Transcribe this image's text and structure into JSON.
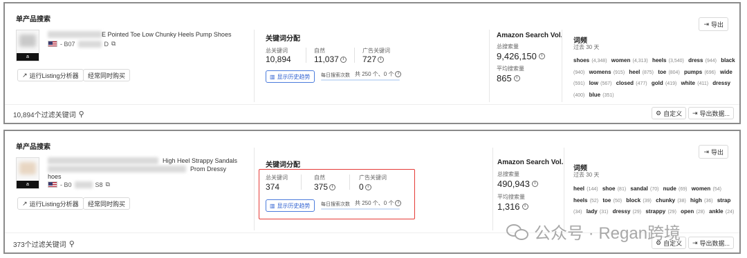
{
  "cards": [
    {
      "section_title": "单产品搜索",
      "export_label": "导出",
      "product_title": "E Pointed Toe Low Chunky Heels Pump Shoes",
      "product_title_2": "",
      "asin_prefix": "- B07",
      "asin_suffix": "D",
      "btn_listing": "运行Listing分析器",
      "btn_often": "经常同时购买",
      "kw": {
        "title": "关键词分配",
        "total_label": "总关键词",
        "total_value": "10,894",
        "organic_label": "自然",
        "organic_value": "11,037",
        "ad_label": "广告关键词",
        "ad_value": "727",
        "trend_btn": "显示历史趋势",
        "daily_label": "每日搜索次数",
        "daily_count": "共 250 个、0 个"
      },
      "amazon": {
        "title": "Amazon Search Vol.",
        "total_label": "总搜索量",
        "total_value": "9,426,150",
        "avg_label": "平均搜索量",
        "avg_value": "865"
      },
      "wordfreq": {
        "title": "词频",
        "subtitle": "过去 30 天",
        "words": [
          {
            "w": "shoes",
            "c": "(4,348)"
          },
          {
            "w": "women",
            "c": "(4,313)"
          },
          {
            "w": "heels",
            "c": "(3,540)"
          },
          {
            "w": "dress",
            "c": "(944)"
          },
          {
            "w": "black",
            "c": "(940)"
          },
          {
            "w": "womens",
            "c": "(915)"
          },
          {
            "w": "heel",
            "c": "(875)"
          },
          {
            "w": "toe",
            "c": "(804)"
          },
          {
            "w": "pumps",
            "c": "(696)"
          },
          {
            "w": "wide",
            "c": "(591)"
          },
          {
            "w": "low",
            "c": "(567)"
          },
          {
            "w": "closed",
            "c": "(477)"
          },
          {
            "w": "gold",
            "c": "(419)"
          },
          {
            "w": "white",
            "c": "(411)"
          },
          {
            "w": "dressy",
            "c": "(400)"
          },
          {
            "w": "blue",
            "c": "(351)"
          }
        ]
      },
      "footer_keywords": "10,894个过滤关键词",
      "customize_label": "自定义",
      "export_data_label": "导出数据..."
    },
    {
      "section_title": "单产品搜索",
      "export_label": "导出",
      "product_title": "High Heel Strappy Sandals",
      "product_title_2": "Prom Dressy",
      "product_title_3": "hoes",
      "asin_prefix": "- B0",
      "asin_suffix": "S8",
      "btn_listing": "运行Listing分析器",
      "btn_often": "经常同时购买",
      "kw": {
        "title": "关键词分配",
        "total_label": "总关键词",
        "total_value": "374",
        "organic_label": "自然",
        "organic_value": "375",
        "ad_label": "广告关键词",
        "ad_value": "0",
        "trend_btn": "显示历史趋势",
        "daily_label": "每日搜索次数",
        "daily_count": "共 250 个、0 个"
      },
      "amazon": {
        "title": "Amazon Search Vol.",
        "total_label": "总搜索量",
        "total_value": "490,943",
        "avg_label": "平均搜索量",
        "avg_value": "1,316"
      },
      "wordfreq": {
        "title": "词频",
        "subtitle": "过去 30 天",
        "words": [
          {
            "w": "heel",
            "c": "(144)"
          },
          {
            "w": "shoe",
            "c": "(81)"
          },
          {
            "w": "sandal",
            "c": "(70)"
          },
          {
            "w": "nude",
            "c": "(69)"
          },
          {
            "w": "women",
            "c": "(54)"
          },
          {
            "w": "heels",
            "c": "(52)"
          },
          {
            "w": "toe",
            "c": "(50)"
          },
          {
            "w": "block",
            "c": "(39)"
          },
          {
            "w": "chunky",
            "c": "(38)"
          },
          {
            "w": "high",
            "c": "(36)"
          },
          {
            "w": "strap",
            "c": "(34)"
          },
          {
            "w": "lady",
            "c": "(31)"
          },
          {
            "w": "dressy",
            "c": "(29)"
          },
          {
            "w": "strappy",
            "c": "(29)"
          },
          {
            "w": "open",
            "c": "(28)"
          },
          {
            "w": "ankle",
            "c": "(24)"
          }
        ]
      },
      "footer_keywords": "373个过滤关键词",
      "customize_label": "自定义",
      "export_data_label": "导出数据..."
    }
  ],
  "watermark": "公众号 · Regan跨境"
}
